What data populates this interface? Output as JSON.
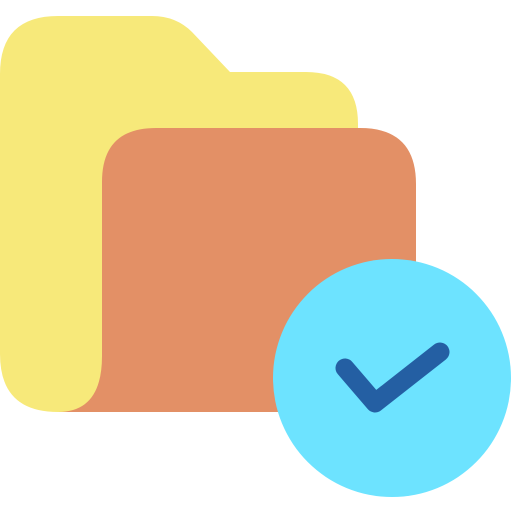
{
  "icon": {
    "name": "folder-check-icon",
    "colors": {
      "background": "#ffffff",
      "folder_back": "#f7e97a",
      "folder_front": "#e39066",
      "badge": "#6de3ff",
      "check": "#245fa3"
    }
  }
}
